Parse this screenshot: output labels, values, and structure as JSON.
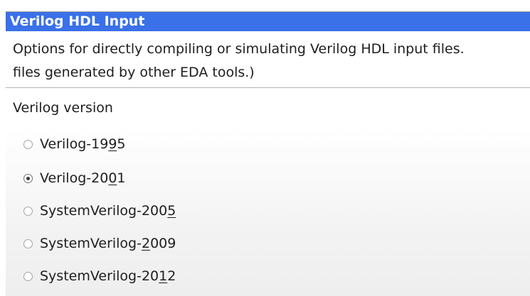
{
  "header": {
    "title": "Verilog HDL Input"
  },
  "description": {
    "line1": "Options for directly compiling or simulating Verilog HDL input files.",
    "line2": "files generated by other EDA tools.)"
  },
  "version_group": {
    "label": "Verilog version",
    "options": [
      {
        "pre": "Verilog-19",
        "mnemonic": "9",
        "post": "5",
        "checked": false
      },
      {
        "pre": "Verilog-20",
        "mnemonic": "0",
        "post": "1",
        "checked": true
      },
      {
        "pre": "SystemVerilog-200",
        "mnemonic": "5",
        "post": "",
        "checked": false
      },
      {
        "pre": "SystemVerilog-",
        "mnemonic": "2",
        "post": "009",
        "checked": false
      },
      {
        "pre": "SystemVerilog-20",
        "mnemonic": "1",
        "post": "2",
        "checked": false
      }
    ],
    "selected": "Verilog-2001"
  },
  "colors": {
    "header_bg": "#3a70e8",
    "header_text": "#ffffff"
  }
}
